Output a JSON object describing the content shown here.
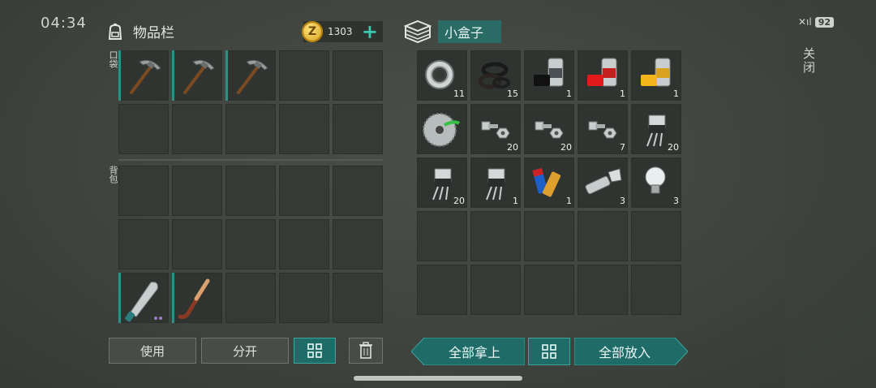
{
  "status": {
    "time": "04:34",
    "battery": "92"
  },
  "side": {
    "close_label": "关闭"
  },
  "inventory": {
    "title": "物品栏",
    "coins": "1303",
    "pocket_label": "口袋",
    "backpack_label": "背包",
    "pocket_items": [
      "pickaxe",
      "pickaxe",
      "pickaxe",
      "",
      "",
      "",
      "",
      "",
      "",
      ""
    ],
    "backpack_items": [
      "",
      "",
      "",
      "",
      "",
      "",
      "",
      "",
      "",
      "",
      "machete",
      "hockey-stick",
      "",
      "",
      ""
    ]
  },
  "box": {
    "title": "小盒子",
    "items": [
      {
        "icon": "bearing",
        "count": "11"
      },
      {
        "icon": "rubber-rings",
        "count": "15"
      },
      {
        "icon": "spray-paint-black",
        "count": "1"
      },
      {
        "icon": "spray-paint-red",
        "count": "1"
      },
      {
        "icon": "spray-paint-yellow",
        "count": "1"
      },
      {
        "icon": "saw-blade",
        "count": ""
      },
      {
        "icon": "bolts",
        "count": "20"
      },
      {
        "icon": "bolts",
        "count": "20"
      },
      {
        "icon": "bolts",
        "count": "7"
      },
      {
        "icon": "transistor",
        "count": "20"
      },
      {
        "icon": "transistor",
        "count": "20"
      },
      {
        "icon": "transistor",
        "count": "1"
      },
      {
        "icon": "batteries",
        "count": "1"
      },
      {
        "icon": "flashlight",
        "count": "3"
      },
      {
        "icon": "light-bulb",
        "count": "3"
      }
    ]
  },
  "buttons": {
    "use": "使用",
    "split": "分开",
    "take_all": "全部拿上",
    "put_all": "全部放入"
  },
  "colors": {
    "accent": "#1f6b67",
    "slot": "#353a36",
    "coin": "#d29b17"
  }
}
